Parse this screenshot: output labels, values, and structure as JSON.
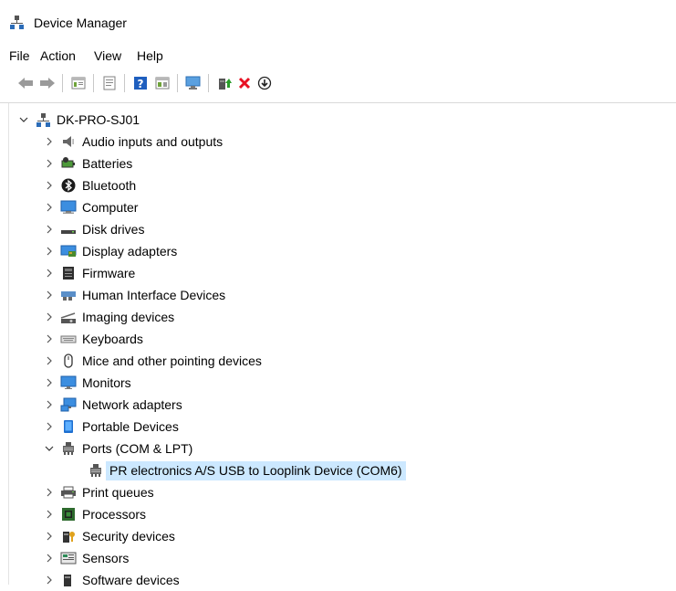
{
  "window": {
    "title": "Device Manager"
  },
  "menu": [
    "File",
    "Action",
    "View",
    "Help"
  ],
  "toolbar": [
    "back-icon",
    "forward-icon",
    "show-hide-tree-icon",
    "properties-icon",
    "help-icon",
    "view-icon",
    "scan-hardware-icon",
    "update-driver-icon",
    "uninstall-icon",
    "enable-device-icon"
  ],
  "tree": {
    "root": "DK-PRO-SJ01",
    "categories": [
      "Audio inputs and outputs",
      "Batteries",
      "Bluetooth",
      "Computer",
      "Disk drives",
      "Display adapters",
      "Firmware",
      "Human Interface Devices",
      "Imaging devices",
      "Keyboards",
      "Mice and other pointing devices",
      "Monitors",
      "Network adapters",
      "Portable Devices",
      "Ports (COM & LPT)",
      "Print queues",
      "Processors",
      "Security devices",
      "Sensors",
      "Software devices"
    ],
    "expanded_category": "Ports (COM & LPT)",
    "selected_device": "PR electronics A/S USB to Looplink Device (COM6)"
  },
  "colors": {
    "selection": "#cce8ff",
    "accent": "#1e7bd3",
    "uninstall": "#e81123",
    "enable": "#2a9d2a"
  }
}
